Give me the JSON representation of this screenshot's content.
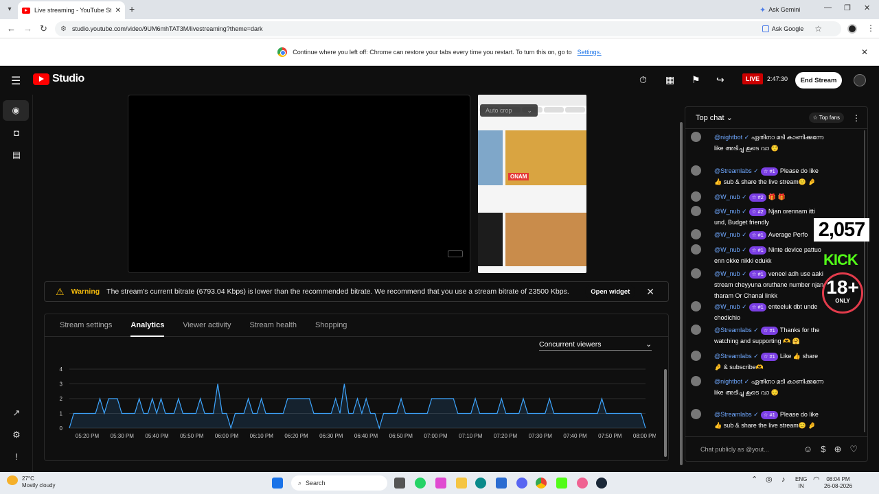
{
  "browser": {
    "tab_title": "Live streaming - YouTube Studio",
    "new_tab": "+",
    "ask_gemini": "Ask Gemini",
    "url": "studio.youtube.com/video/9UM6mhTAT3M/livestreaming?theme=dark",
    "ask_google": "Ask Google",
    "restore_msg": "Continue where you left off: Chrome can restore your tabs every time you restart. To turn this on, go to",
    "restore_link": "Settings."
  },
  "header": {
    "logo_text": "Studio",
    "live_label": "LIVE",
    "live_time": "2:47:30",
    "end_stream": "End Stream"
  },
  "preview": {
    "autocrop": "Auto crop",
    "onam": "ONAM"
  },
  "warning": {
    "label": "Warning",
    "text": "The stream's current bitrate (6793.04 Kbps) is lower than the recommended bitrate. We recommend that you use a stream bitrate of 23500 Kbps.",
    "open_widget": "Open widget"
  },
  "tabs": [
    "Stream settings",
    "Analytics",
    "Viewer activity",
    "Stream health",
    "Shopping"
  ],
  "metric": "Concurrent viewers",
  "chart_data": {
    "type": "area",
    "x_ticks": [
      "05:20 PM",
      "05:30 PM",
      "05:40 PM",
      "05:50 PM",
      "06:00 PM",
      "06:10 PM",
      "06:20 PM",
      "06:30 PM",
      "06:40 PM",
      "06:50 PM",
      "07:00 PM",
      "07:10 PM",
      "07:20 PM",
      "07:30 PM",
      "07:40 PM",
      "07:50 PM",
      "08:00 PM"
    ],
    "y_ticks": [
      "0",
      "1",
      "2",
      "3",
      "4"
    ],
    "ylim": [
      0,
      4
    ],
    "values": [
      0,
      1,
      1,
      1,
      1,
      1,
      1,
      2,
      1,
      2,
      2,
      2,
      1,
      1,
      1,
      1,
      2,
      1,
      1,
      2,
      1,
      2,
      1,
      1,
      1,
      2,
      1,
      1,
      1,
      1,
      2,
      1,
      1,
      1,
      3,
      1,
      1,
      0,
      1,
      1,
      1,
      2,
      1,
      1,
      2,
      1,
      1,
      1,
      1,
      1,
      2,
      2,
      2,
      2,
      2,
      2,
      1,
      1,
      1,
      1,
      1,
      2,
      1,
      3,
      1,
      1,
      2,
      1,
      2,
      1,
      1,
      0,
      1,
      1,
      1,
      1,
      2,
      1,
      1,
      1,
      1,
      1,
      1,
      2,
      2,
      2,
      2,
      2,
      2,
      1,
      1,
      1,
      1,
      2,
      1,
      1,
      1,
      1,
      1,
      2,
      1,
      1,
      1,
      1,
      2,
      1,
      1,
      1,
      1,
      1,
      2,
      1,
      1,
      1,
      1,
      1,
      1,
      1,
      1,
      1,
      1,
      1,
      2,
      1,
      1,
      1,
      1,
      1,
      1,
      1,
      1,
      1,
      0
    ],
    "color": "#3ea6ff",
    "grid": true
  },
  "chat": {
    "mode": "Top chat",
    "top_fans": "Top fans",
    "placeholder": "Chat publicly as @yout...",
    "messages": [
      {
        "author": "@nightbot",
        "badge": "",
        "text": "ഏതിനാ മടി കാണിക്കുന്നേ like അടിച്ചു കൂടെ വാ 😌"
      },
      {
        "author": "@Streamlabs",
        "badge": "#1",
        "text": "Please do like 👍 sub & share the live stream🙂 🤌"
      },
      {
        "author": "@W_nub",
        "badge": "#2",
        "text": "🎁 🎁"
      },
      {
        "author": "@W_nub",
        "badge": "#2",
        "text": "Njan orennam itti und, Budget friendly"
      },
      {
        "author": "@W_nub",
        "badge": "#1",
        "text": "Average Perfo"
      },
      {
        "author": "@W_nub",
        "badge": "#1",
        "text": "Ninte device pattuo enn okke nikki edukk"
      },
      {
        "author": "@W_nub",
        "badge": "#1",
        "text": "veneel adh use aaki stream cheyyuna oruthane number njan tharam Or Chanal linkk"
      },
      {
        "author": "@W_nub",
        "badge": "#1",
        "text": "enteeluk dbt unde chodichio"
      },
      {
        "author": "@Streamlabs",
        "badge": "#1",
        "text": "Thanks for the watching and supporting 🫶 🤗"
      },
      {
        "author": "@Streamlabs",
        "badge": "#1",
        "text": "Like 👍 share 🤌 & subscribe🫶"
      },
      {
        "author": "@nightbot",
        "badge": "",
        "text": "ഏതിനാ മടി കാണിക്കുന്നേ like അടിച്ചു കൂടെ വാ 😌"
      },
      {
        "author": "@Streamlabs",
        "badge": "#1",
        "text": "Please do like 👍 sub & share the live stream🙂 🤌"
      }
    ]
  },
  "overlay": {
    "counter": "2,057",
    "kick": "KICK",
    "age": "18+",
    "age_sub": "ONLY"
  },
  "taskbar": {
    "temp": "27°C",
    "weather": "Mostly cloudy",
    "search": "Search",
    "lang1": "ENG",
    "lang2": "IN",
    "time": "08:04 PM",
    "date": "26-08-2026"
  }
}
